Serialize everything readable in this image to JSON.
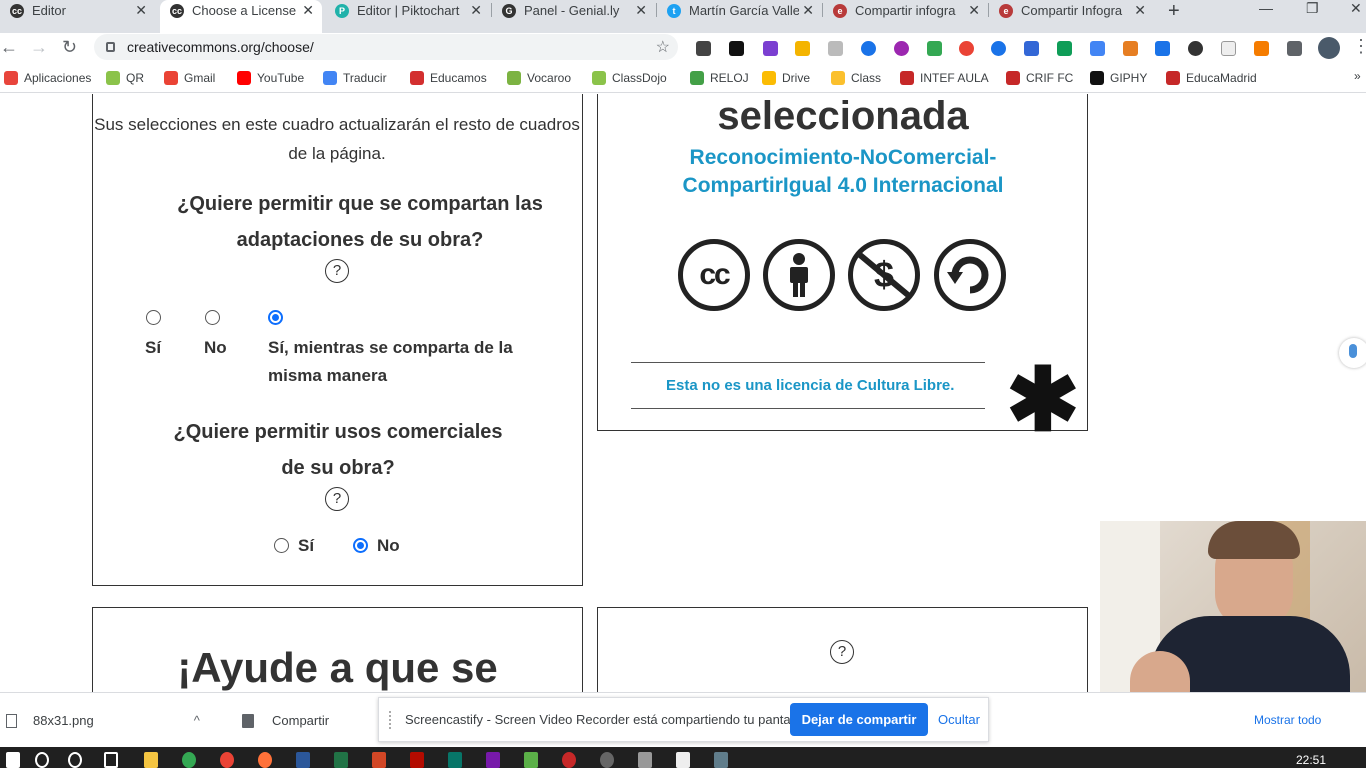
{
  "browser": {
    "tabs": [
      {
        "title": "Editor",
        "favicon": "cc-icon",
        "color": "#333333"
      },
      {
        "title": "Choose a License",
        "favicon": "cc-icon",
        "color": "#333333",
        "active": true
      },
      {
        "title": "Editor | Piktochart",
        "favicon": "piktochart-icon",
        "color": "#20b2aa"
      },
      {
        "title": "Panel - Genial.ly",
        "favicon": "genially-icon",
        "color": "#333333"
      },
      {
        "title": "Martín García Valle",
        "favicon": "twitter-icon",
        "color": "#1da1f2"
      },
      {
        "title": "Compartir infogra",
        "favicon": "educa-icon",
        "color": "#b83a3a"
      },
      {
        "title": "Compartir Infogra",
        "favicon": "educa-icon",
        "color": "#b83a3a"
      }
    ],
    "new_tab": "+",
    "window_controls": {
      "minimize": "—",
      "maximize": "❐",
      "close": "✕"
    },
    "address": "creativecommons.org/choose/"
  },
  "bookmarks": [
    {
      "label": "Aplicaciones",
      "icon": "apps-grid-icon",
      "color": "#e8453c"
    },
    {
      "label": "QR",
      "icon": "qr-icon",
      "color": "#8bc34a"
    },
    {
      "label": "Gmail",
      "icon": "gmail-icon",
      "color": "#ea4335"
    },
    {
      "label": "YouTube",
      "icon": "youtube-icon",
      "color": "#ff0000"
    },
    {
      "label": "Traducir",
      "icon": "translate-icon",
      "color": "#4285f4"
    },
    {
      "label": "Educamos",
      "icon": "educamos-icon",
      "color": "#d32f2f"
    },
    {
      "label": "Vocaroo",
      "icon": "vocaroo-icon",
      "color": "#7cb342"
    },
    {
      "label": "ClassDojo",
      "icon": "classdojo-icon",
      "color": "#8bc34a"
    },
    {
      "label": "RELOJ",
      "icon": "clock-icon",
      "color": "#43a047"
    },
    {
      "label": "Drive",
      "icon": "drive-icon",
      "color": "#fbbc04"
    },
    {
      "label": "Class",
      "icon": "class-icon",
      "color": "#fbc02d"
    },
    {
      "label": "INTEF AULA",
      "icon": "intef-icon",
      "color": "#c62828"
    },
    {
      "label": "CRIF FC",
      "icon": "crif-icon",
      "color": "#c62828"
    },
    {
      "label": "GIPHY",
      "icon": "giphy-icon",
      "color": "#111111"
    },
    {
      "label": "EducaMadrid",
      "icon": "educamadrid-icon",
      "color": "#c62828"
    }
  ],
  "page": {
    "subtitle": "Sus selecciones en este cuadro actualizarán el resto de cuadros de la página.",
    "q1": "¿Quiere permitir que se compartan las adaptaciones de su obra?",
    "q1_help": "?",
    "q1_options": {
      "yes": "Sí",
      "no": "No",
      "sharealike": "Sí, mientras se comparta de la misma manera"
    },
    "q2": "¿Quiere permitir usos comerciales de su obra?",
    "q2_help": "?",
    "q2_options": {
      "yes": "Sí",
      "no": "No"
    },
    "selected_title": "seleccionada",
    "license_name": "Reconocimiento-NoComercial-CompartirIgual 4.0 Internacional",
    "license_icons": [
      "cc-icon",
      "attribution-icon",
      "noncommercial-icon",
      "sharealike-icon"
    ],
    "culture_note": "Esta no es una licencia de Cultura Libre.",
    "asterisk": "✱",
    "help_title": "¡Ayude a que se",
    "box4_help": "?"
  },
  "downloads": {
    "file": "88x31.png",
    "share_item": "Compartir",
    "show_all": "Mostrar todo"
  },
  "screencastify": {
    "message": "Screencastify - Screen Video Recorder está compartiendo tu pantalla.",
    "stop": "Dejar de compartir",
    "hide": "Ocultar"
  },
  "taskbar": {
    "time": "22:51"
  }
}
